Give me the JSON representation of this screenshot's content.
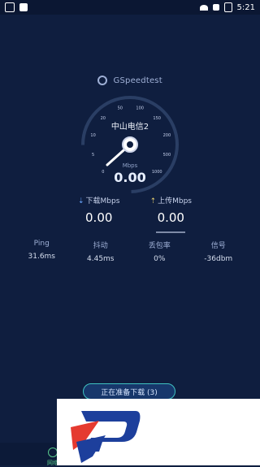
{
  "status_bar": {
    "time": "5:21"
  },
  "brand": {
    "name": "GSpeedtest"
  },
  "gauge": {
    "ticks": [
      "0",
      "5",
      "10",
      "20",
      "50",
      "100",
      "150",
      "200",
      "500",
      "1000"
    ],
    "server": "中山电信2",
    "unit": "Mbps",
    "speed": "0.00"
  },
  "download": {
    "label": "下载Mbps",
    "value": "0.00"
  },
  "upload": {
    "label": "上传Mbps",
    "value": "0.00"
  },
  "stats": [
    {
      "name": "Ping",
      "value": "31.6ms"
    },
    {
      "name": "抖动",
      "value": "4.45ms"
    },
    {
      "name": "丢包率",
      "value": "0%"
    },
    {
      "name": "信号",
      "value": "-36dbm"
    }
  ],
  "status_button": {
    "label": "正在准备下载 (3)"
  },
  "bottom_nav": {
    "network_tab": "网络"
  }
}
